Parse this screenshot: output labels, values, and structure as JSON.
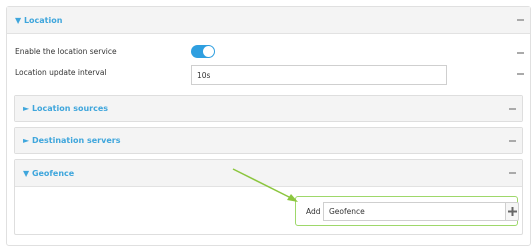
{
  "location": {
    "title": "▼ Location",
    "enable_label": "Enable the location service",
    "enabled": true,
    "interval_label": "Location update interval",
    "interval_value": "10s"
  },
  "sections": {
    "sources": {
      "title": "► Location sources"
    },
    "destinations": {
      "title": "► Destination servers"
    },
    "geofence": {
      "title": "▼ Geofence",
      "add_label": "Add",
      "add_value": "Geofence"
    }
  },
  "colors": {
    "accent": "#3fa6dc",
    "toggle_on": "#2f9fe0",
    "highlight_green": "#8cc63f"
  }
}
